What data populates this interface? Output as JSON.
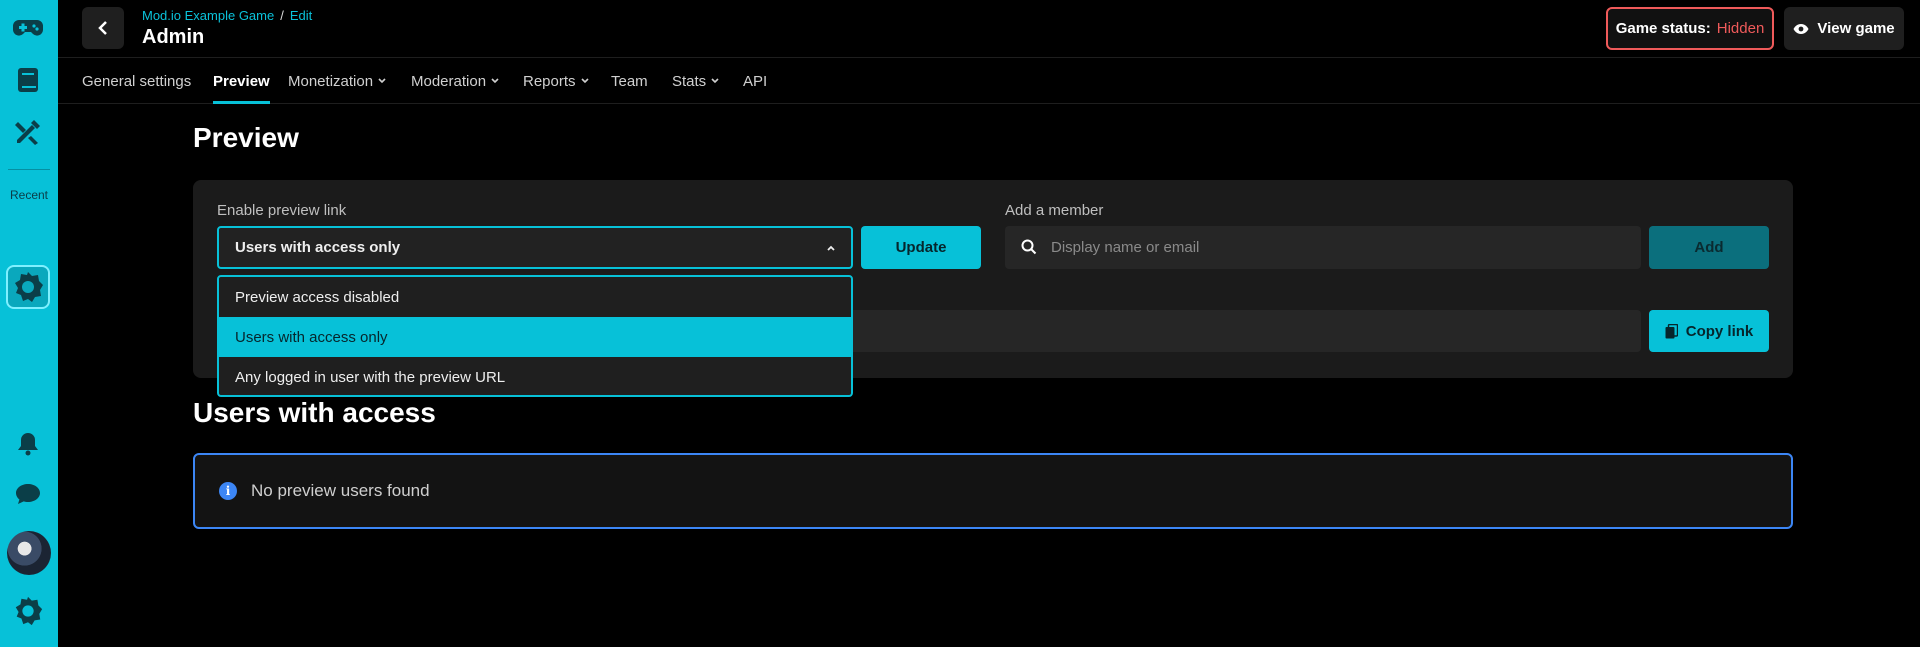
{
  "header": {
    "breadcrumb": [
      "Mod.io Example Game",
      "/",
      "Edit"
    ],
    "title": "Admin",
    "status_label": "Game status:",
    "status_value": "Hidden",
    "view_button": "View game",
    "status_color": "#ef5a5a"
  },
  "sidebar": {
    "recent_label": "Recent",
    "icons": [
      "gamepad-icon",
      "book-icon",
      "tools-icon",
      "game-logo-icon",
      "bell-icon",
      "chat-icon",
      "avatar",
      "modio-logo-icon"
    ]
  },
  "tabs": [
    {
      "label": "General settings",
      "dropdown": false
    },
    {
      "label": "Preview",
      "dropdown": false,
      "active": true
    },
    {
      "label": "Monetization",
      "dropdown": true
    },
    {
      "label": "Moderation",
      "dropdown": true
    },
    {
      "label": "Reports",
      "dropdown": true
    },
    {
      "label": "Team",
      "dropdown": false
    },
    {
      "label": "Stats",
      "dropdown": true
    },
    {
      "label": "API",
      "dropdown": false
    }
  ],
  "preview": {
    "heading": "Preview",
    "enable_label": "Enable preview link",
    "selected_value": "Users with access only",
    "update_button": "Update",
    "member_label": "Add a member",
    "member_placeholder": "Display name or email",
    "add_button": "Add",
    "copy_button": "Copy link",
    "options": [
      "Preview access disabled",
      "Users with access only",
      "Any logged in user with the preview URL"
    ]
  },
  "users": {
    "heading": "Users with access",
    "empty_message": "No preview users found"
  },
  "colors": {
    "accent": "#07c1d8",
    "info": "#3c86f5"
  }
}
